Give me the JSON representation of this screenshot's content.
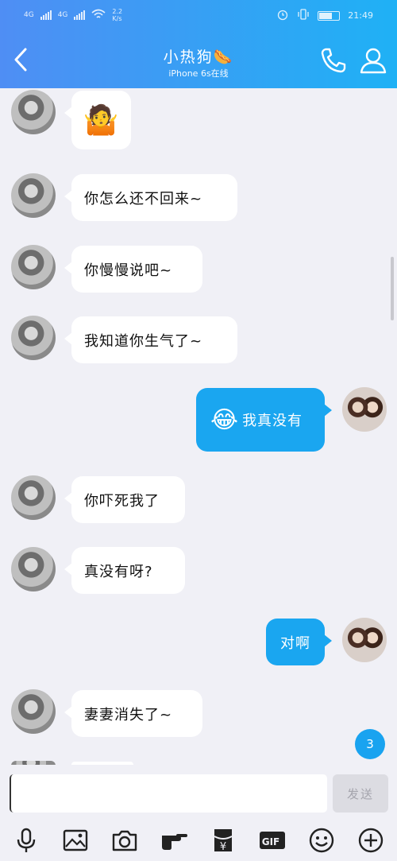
{
  "status_bar": {
    "network1": "4G",
    "network2": "4G",
    "speed": "2.2 K/s",
    "time": "21:49"
  },
  "header": {
    "title": "小热狗🌭",
    "subtitle": "iPhone 6s在线"
  },
  "messages": [
    {
      "side": "in",
      "text": "",
      "emoji": "🤷"
    },
    {
      "side": "in",
      "text": "你怎么还不回来~"
    },
    {
      "side": "in",
      "text": "你慢慢说吧~"
    },
    {
      "side": "in",
      "text": "我知道你生气了~"
    },
    {
      "side": "out",
      "text": "我真没有",
      "emoji": "😂"
    },
    {
      "side": "in",
      "text": "你吓死我了"
    },
    {
      "side": "in",
      "text": "真没有呀?"
    },
    {
      "side": "out",
      "text": "对啊"
    },
    {
      "side": "in",
      "text": "妻妻消失了~"
    }
  ],
  "unread_badge": "3",
  "input": {
    "value": "",
    "send_label": "发送"
  },
  "toolbar": {
    "icons": [
      "microphone-icon",
      "image-icon",
      "camera-icon",
      "poke-icon",
      "red-packet-icon",
      "gif-icon",
      "emoji-icon",
      "plus-icon"
    ],
    "gif_label": "GIF",
    "yen_label": "¥"
  },
  "colors": {
    "header_start": "#4f8ef4",
    "header_end": "#1fb1f5",
    "outgoing_bubble": "#1aa6f0",
    "background": "#f0f0f6"
  }
}
